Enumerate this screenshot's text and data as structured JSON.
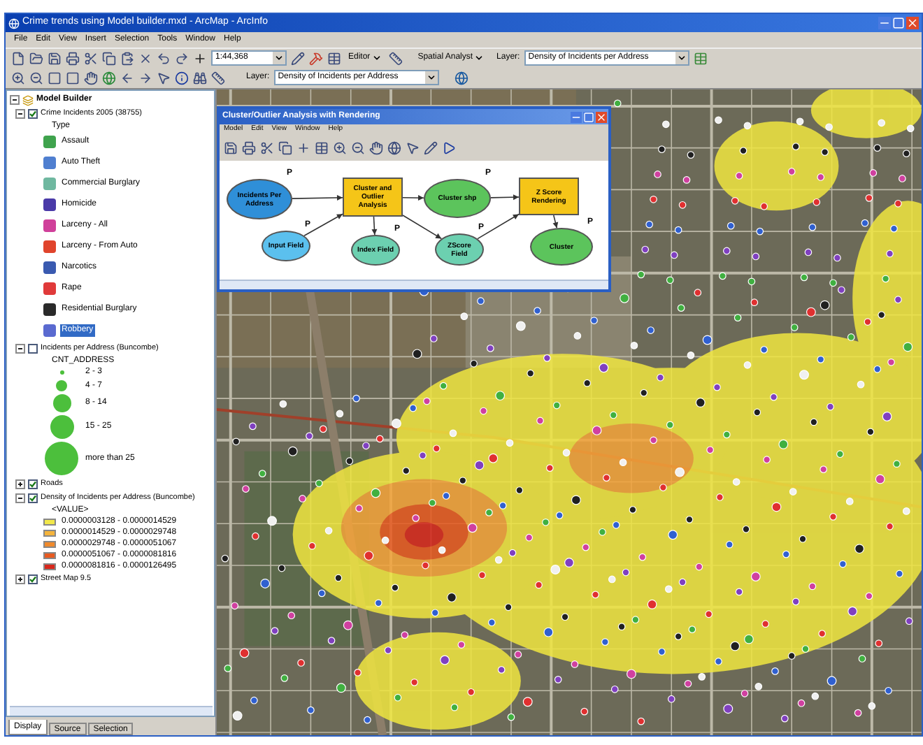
{
  "window": {
    "title": "Crime trends using Model builder.mxd - ArcMap - ArcInfo"
  },
  "menu": [
    "File",
    "Edit",
    "View",
    "Insert",
    "Selection",
    "Tools",
    "Window",
    "Help"
  ],
  "toolbar": {
    "scale": "1:44,368",
    "editor": "Editor",
    "spatial": "Spatial Analyst",
    "layer_label": "Layer:",
    "layer_value": "Density of Incidents per Address"
  },
  "toolbar2": {
    "layer_label": "Layer:",
    "layer_value": "Density of Incidents per Address"
  },
  "toc": {
    "frame": {
      "label": "Model Builder",
      "expanded": true
    },
    "layers": [
      {
        "label": "Crime Incidents 2005 (38755)",
        "checked": true,
        "expanded": true,
        "heading": "Type",
        "legend": [
          {
            "kind": "symbol",
            "label": "Assault",
            "color": "#3fa34d",
            "selected": false
          },
          {
            "kind": "symbol",
            "label": "Auto Theft",
            "color": "#4f7fd0",
            "selected": false
          },
          {
            "kind": "symbol",
            "label": "Commercial Burglary",
            "color": "#6fb8a0",
            "selected": false
          },
          {
            "kind": "symbol",
            "label": "Homicide",
            "color": "#4a3aa8",
            "selected": false
          },
          {
            "kind": "symbol",
            "label": "Larceny - All",
            "color": "#d0409a",
            "selected": false
          },
          {
            "kind": "symbol",
            "label": "Larceny - From Auto",
            "color": "#e0442c",
            "selected": false
          },
          {
            "kind": "symbol",
            "label": "Narcotics",
            "color": "#3a5ab0",
            "selected": false
          },
          {
            "kind": "symbol",
            "label": "Rape",
            "color": "#e03a3a",
            "selected": false
          },
          {
            "kind": "symbol",
            "label": "Residential Burglary",
            "color": "#2a2a2a",
            "selected": false
          },
          {
            "kind": "symbol",
            "label": "Robbery",
            "color": "#5a6ad0",
            "selected": true
          }
        ]
      },
      {
        "label": "Incidents per Address (Buncombe)",
        "checked": false,
        "expanded": true,
        "heading": "CNT_ADDRESS",
        "legend": [
          {
            "kind": "circle",
            "label": "2 - 3",
            "color": "#4cbf3c"
          },
          {
            "kind": "circle",
            "label": "4 - 7",
            "color": "#4cbf3c"
          },
          {
            "kind": "circle",
            "label": "8 - 14",
            "color": "#4cbf3c"
          },
          {
            "kind": "circle",
            "label": "15 - 25",
            "color": "#4cbf3c"
          },
          {
            "kind": "circle",
            "label": "more than 25",
            "color": "#4cbf3c"
          }
        ]
      },
      {
        "label": "Roads",
        "checked": true,
        "expanded": false
      },
      {
        "label": "Density of Incidents per Address (Buncombe)",
        "checked": true,
        "expanded": true,
        "heading": "<VALUE>",
        "legend": [
          {
            "kind": "swatch",
            "label": "0.0000003128 - 0.0000014529",
            "color": "#f2e84a"
          },
          {
            "kind": "swatch",
            "label": "0.0000014529 - 0.0000029748",
            "color": "#f5b43c"
          },
          {
            "kind": "swatch",
            "label": "0.0000029748 - 0.0000051067",
            "color": "#f08a2c"
          },
          {
            "kind": "swatch",
            "label": "0.0000051067 - 0.0000081816",
            "color": "#e85a20"
          },
          {
            "kind": "swatch",
            "label": "0.0000081816 - 0.0000126495",
            "color": "#d8281c"
          }
        ]
      },
      {
        "label": "Street Map 9.5",
        "checked": true,
        "expanded": false
      }
    ],
    "tabs": [
      {
        "label": "Display",
        "selected": true
      },
      {
        "label": "Source",
        "selected": false
      },
      {
        "label": "Selection",
        "selected": false
      }
    ]
  },
  "model": {
    "title": "Cluster/Outlier Analysis with Rendering",
    "menu": [
      "Model",
      "Edit",
      "View",
      "Window",
      "Help"
    ],
    "nodes": [
      {
        "kind": "input",
        "label": "Incidents Per Address",
        "flag": "P"
      },
      {
        "kind": "tool",
        "label": "Cluster and Outlier Analysis"
      },
      {
        "kind": "output",
        "label": "Cluster shp",
        "flag": "P"
      },
      {
        "kind": "tool",
        "label": "Z Score Rendering"
      },
      {
        "kind": "param",
        "label": "Input Field",
        "flag": "P"
      },
      {
        "kind": "field",
        "label": "Index Field",
        "flag": "P"
      },
      {
        "kind": "field",
        "label": "ZScore Field",
        "flag": "P"
      },
      {
        "kind": "output",
        "label": "Cluster",
        "flag": "P"
      }
    ]
  }
}
